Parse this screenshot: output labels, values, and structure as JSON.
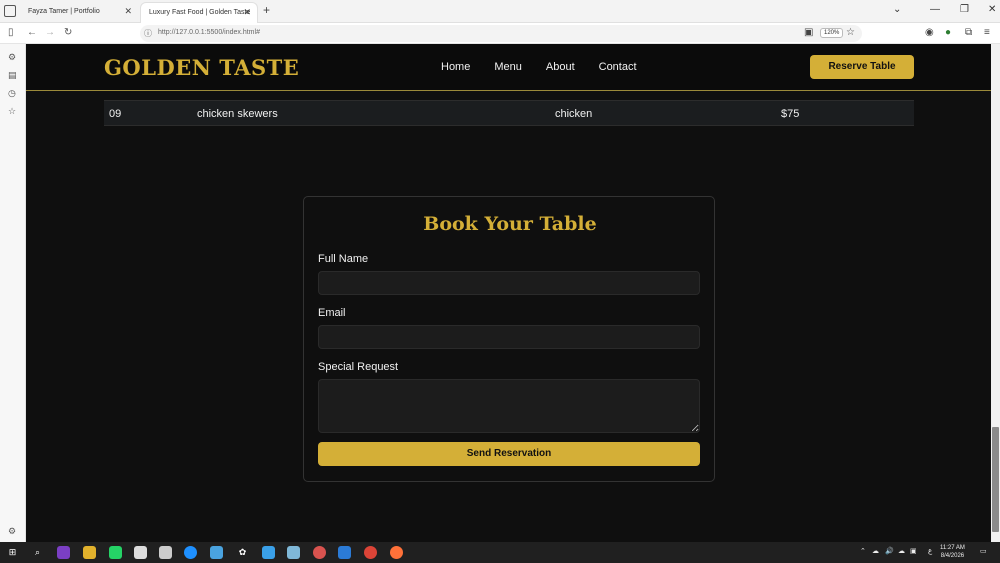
{
  "browser": {
    "tabs": [
      {
        "title": "Fayza Tamer | Portfolio"
      },
      {
        "title": "Luxury Fast Food | Golden Taste"
      }
    ],
    "url": "http://127.0.0.1:5500/index.html#",
    "zoom": "120%"
  },
  "site": {
    "logo": "GOLDEN TASTE",
    "nav": [
      "Home",
      "Menu",
      "About",
      "Contact"
    ],
    "reserve_button": "Reserve Table",
    "accent_color": "#d4af37"
  },
  "menu_table": {
    "rows": [
      {
        "no": "09",
        "name": "chicken skewers",
        "category": "chicken",
        "price": "$75"
      }
    ]
  },
  "reservation_form": {
    "title": "Book Your Table",
    "fields": [
      {
        "label": "Full Name",
        "value": ""
      },
      {
        "label": "Email",
        "value": ""
      },
      {
        "label": "Special Request",
        "value": ""
      }
    ],
    "submit_label": "Send Reservation"
  },
  "taskbar": {
    "time": "11:27 AM",
    "date": "8/4/2026"
  }
}
